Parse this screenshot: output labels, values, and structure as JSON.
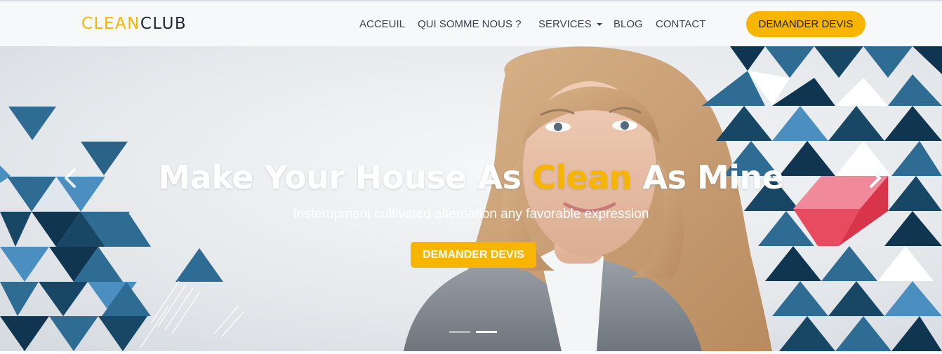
{
  "brand": {
    "part1": "CLEAN",
    "part2": "CLUB"
  },
  "nav": {
    "items": [
      {
        "label": "ACCEUIL"
      },
      {
        "label": "QUI SOMME NOUS ?"
      },
      {
        "label": "SERVICES",
        "has_dropdown": true
      },
      {
        "label": "BLOG"
      },
      {
        "label": "CONTACT"
      }
    ],
    "cta_label": "DEMANDER DEVIS"
  },
  "hero": {
    "title_before": "Make Your House As ",
    "title_highlight": "Clean",
    "title_after": " As Mine",
    "subtitle": "Insterupment cultivated alternation any favorable expression",
    "cta_label": "DEMANDER DEVIS",
    "slides_total": 2,
    "active_slide": 2
  },
  "colors": {
    "accent": "#f7b500",
    "navbar_bg": "#f7f8fa",
    "nav_text": "#3a4450",
    "triangle_dark": "#0f3550",
    "triangle_mid": "#2f6c94",
    "triangle_light": "#4a8fc0",
    "cube_red": "#e84a5f"
  },
  "icons": {
    "prev": "chevron-left-icon",
    "next": "chevron-right-icon",
    "dropdown": "caret-down-icon"
  }
}
